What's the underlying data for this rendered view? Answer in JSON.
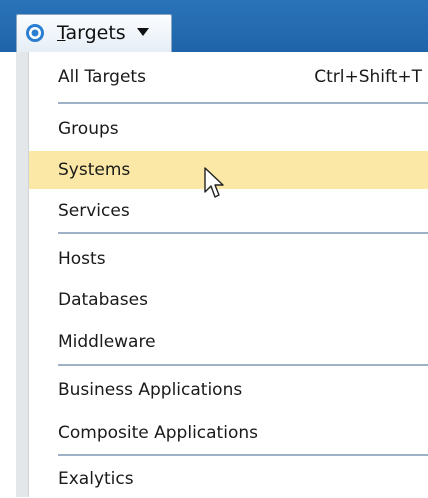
{
  "menubar": {
    "button_label_rest": "argets",
    "button_mnemonic": "T",
    "accent_color": "#1f64a8"
  },
  "menu": {
    "items": [
      {
        "label": "All Targets",
        "shortcut": "Ctrl+Shift+T"
      },
      {
        "label": "Groups"
      },
      {
        "label": "Systems",
        "state": "hover"
      },
      {
        "label": "Services"
      },
      {
        "label": "Hosts"
      },
      {
        "label": "Databases"
      },
      {
        "label": "Middleware"
      },
      {
        "label": "Business Applications"
      },
      {
        "label": "Composite Applications"
      },
      {
        "label": "Exalytics"
      }
    ],
    "hover_color": "#fbe8a6"
  },
  "icons": {
    "menu_icon": "target-icon",
    "dropdown_icon": "caret-down-icon",
    "cursor": "mouse-pointer-icon"
  }
}
